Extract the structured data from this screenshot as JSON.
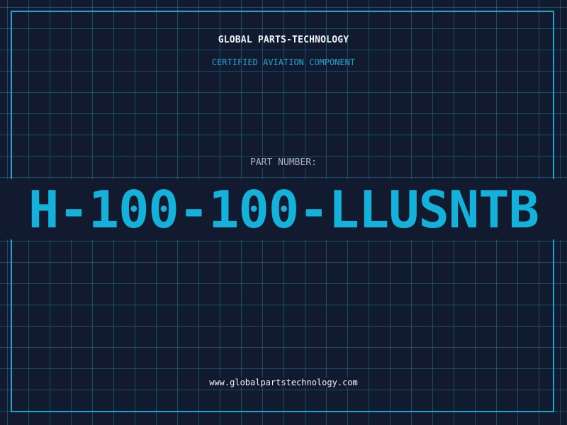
{
  "header": {
    "brand": "GLOBAL PARTS-TECHNOLOGY",
    "tagline": "CERTIFIED AVIATION COMPONENT"
  },
  "part": {
    "label": "PART NUMBER:",
    "number": "H-100-100-LLUSNTB"
  },
  "footer": {
    "url": "www.globalpartstechnology.com"
  },
  "colors": {
    "background": "#121a30",
    "grid": "#207696",
    "accent": "#14b2da",
    "text": "#eef3f8",
    "muted": "#a9b4c2"
  }
}
